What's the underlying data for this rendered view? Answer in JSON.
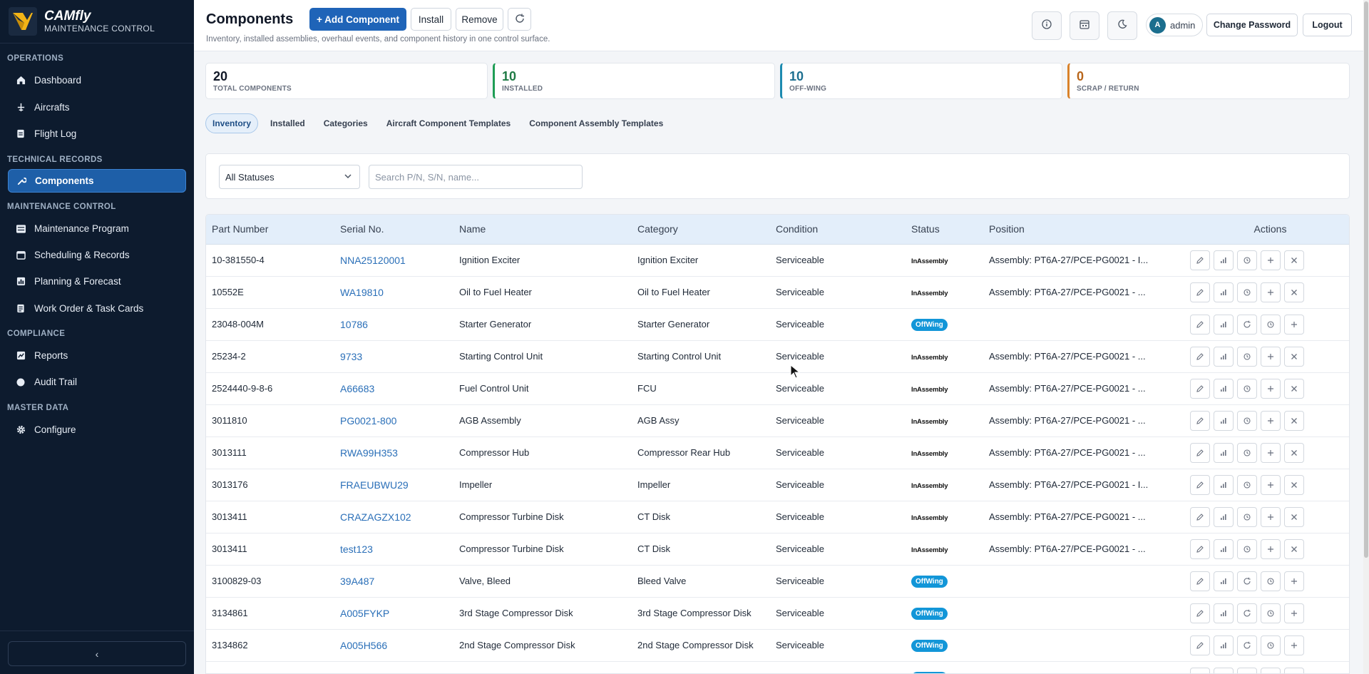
{
  "brand": {
    "name": "CAMfly",
    "subtitle": "MAINTENANCE CONTROL"
  },
  "sidebar": {
    "sections": [
      {
        "label": "OPERATIONS",
        "items": [
          {
            "label": "Dashboard",
            "icon": "home-icon"
          },
          {
            "label": "Aircrafts",
            "icon": "plane-icon"
          },
          {
            "label": "Flight Log",
            "icon": "log-icon"
          }
        ]
      },
      {
        "label": "TECHNICAL RECORDS",
        "items": [
          {
            "label": "Components",
            "icon": "wrench-icon",
            "active": true
          }
        ]
      },
      {
        "label": "MAINTENANCE CONTROL",
        "items": [
          {
            "label": "Maintenance Program",
            "icon": "list-icon"
          },
          {
            "label": "Scheduling & Records",
            "icon": "calendar-icon"
          },
          {
            "label": "Planning & Forecast",
            "icon": "chart-icon"
          },
          {
            "label": "Work Order & Task Cards",
            "icon": "document-icon"
          }
        ]
      },
      {
        "label": "COMPLIANCE",
        "items": [
          {
            "label": "Reports",
            "icon": "report-icon"
          },
          {
            "label": "Audit Trail",
            "icon": "circle-icon"
          }
        ]
      },
      {
        "label": "MASTER DATA",
        "items": [
          {
            "label": "Configure",
            "icon": "gear-icon"
          }
        ]
      }
    ],
    "collapse_label": "‹"
  },
  "header": {
    "title": "Components",
    "subtitle": "Inventory, installed assemblies, overhaul events, and component history in one control surface.",
    "add_label": "+ Add Component",
    "install_label": "Install",
    "remove_label": "Remove",
    "user_initial": "A",
    "user_name": "admin",
    "change_password_label": "Change Password",
    "logout_label": "Logout"
  },
  "stats": [
    {
      "value": "20",
      "label": "TOTAL COMPONENTS",
      "color": "#9ca3af"
    },
    {
      "value": "10",
      "label": "INSTALLED",
      "color": "#1f9d55"
    },
    {
      "value": "10",
      "label": "OFF-WING",
      "color": "#1d8bb0"
    },
    {
      "value": "0",
      "label": "SCRAP / RETURN",
      "color": "#d9822b"
    }
  ],
  "tabs": [
    "Inventory",
    "Installed",
    "Categories",
    "Aircraft Component Templates",
    "Component Assembly Templates"
  ],
  "filters": {
    "status_selected": "All Statuses",
    "search_placeholder": "Search P/N, S/N, name..."
  },
  "table": {
    "columns": [
      "Part Number",
      "Serial No.",
      "Name",
      "Category",
      "Condition",
      "Status",
      "Position",
      "Actions"
    ],
    "rows": [
      {
        "pn": "10-381550-4",
        "sn": "NNA25120001",
        "name": "Ignition Exciter",
        "category": "Ignition Exciter",
        "condition": "Serviceable",
        "status": "InAssembly",
        "position": "Assembly: PT6A-27/PCE-PG0021 - I..."
      },
      {
        "pn": "10552E",
        "sn": "WA19810",
        "name": "Oil to Fuel Heater",
        "category": "Oil to Fuel Heater",
        "condition": "Serviceable",
        "status": "InAssembly",
        "position": "Assembly: PT6A-27/PCE-PG0021 - ..."
      },
      {
        "pn": "23048-004M",
        "sn": "10786",
        "name": "Starter Generator",
        "category": "Starter Generator",
        "condition": "Serviceable",
        "status": "OffWing",
        "position": ""
      },
      {
        "pn": "25234-2",
        "sn": "9733",
        "name": "Starting Control Unit",
        "category": "Starting Control Unit",
        "condition": "Serviceable",
        "status": "InAssembly",
        "position": "Assembly: PT6A-27/PCE-PG0021 - ..."
      },
      {
        "pn": "2524440-9-8-6",
        "sn": "A66683",
        "name": "Fuel Control Unit",
        "category": "FCU",
        "condition": "Serviceable",
        "status": "InAssembly",
        "position": "Assembly: PT6A-27/PCE-PG0021 - ..."
      },
      {
        "pn": "3011810",
        "sn": "PG0021-800",
        "name": "AGB Assembly",
        "category": "AGB Assy",
        "condition": "Serviceable",
        "status": "InAssembly",
        "position": "Assembly: PT6A-27/PCE-PG0021 - ..."
      },
      {
        "pn": "3013111",
        "sn": "RWA99H353",
        "name": "Compressor Hub",
        "category": "Compressor Rear Hub",
        "condition": "Serviceable",
        "status": "InAssembly",
        "position": "Assembly: PT6A-27/PCE-PG0021 - ..."
      },
      {
        "pn": "3013176",
        "sn": "FRAEUBWU29",
        "name": "Impeller",
        "category": "Impeller",
        "condition": "Serviceable",
        "status": "InAssembly",
        "position": "Assembly: PT6A-27/PCE-PG0021 - I..."
      },
      {
        "pn": "3013411",
        "sn": "CRAZAGZX102",
        "name": "Compressor Turbine Disk",
        "category": "CT Disk",
        "condition": "Serviceable",
        "status": "InAssembly",
        "position": "Assembly: PT6A-27/PCE-PG0021 - ..."
      },
      {
        "pn": "3013411",
        "sn": "test123",
        "name": "Compressor Turbine Disk",
        "category": "CT Disk",
        "condition": "Serviceable",
        "status": "InAssembly",
        "position": "Assembly: PT6A-27/PCE-PG0021 - ..."
      },
      {
        "pn": "3100829-03",
        "sn": "39A487",
        "name": "Valve, Bleed",
        "category": "Bleed Valve",
        "condition": "Serviceable",
        "status": "OffWing",
        "position": ""
      },
      {
        "pn": "3134861",
        "sn": "A005FYKP",
        "name": "3rd Stage Compressor Disk",
        "category": "3rd Stage Compressor Disk",
        "condition": "Serviceable",
        "status": "OffWing",
        "position": ""
      },
      {
        "pn": "3134862",
        "sn": "A005H566",
        "name": "2nd Stage Compressor Disk",
        "category": "2nd Stage Compressor Disk",
        "condition": "Serviceable",
        "status": "OffWing",
        "position": ""
      },
      {
        "pn": "",
        "sn": "",
        "name": "",
        "category": "",
        "condition": "",
        "status": "OffWing",
        "position": ""
      }
    ]
  }
}
